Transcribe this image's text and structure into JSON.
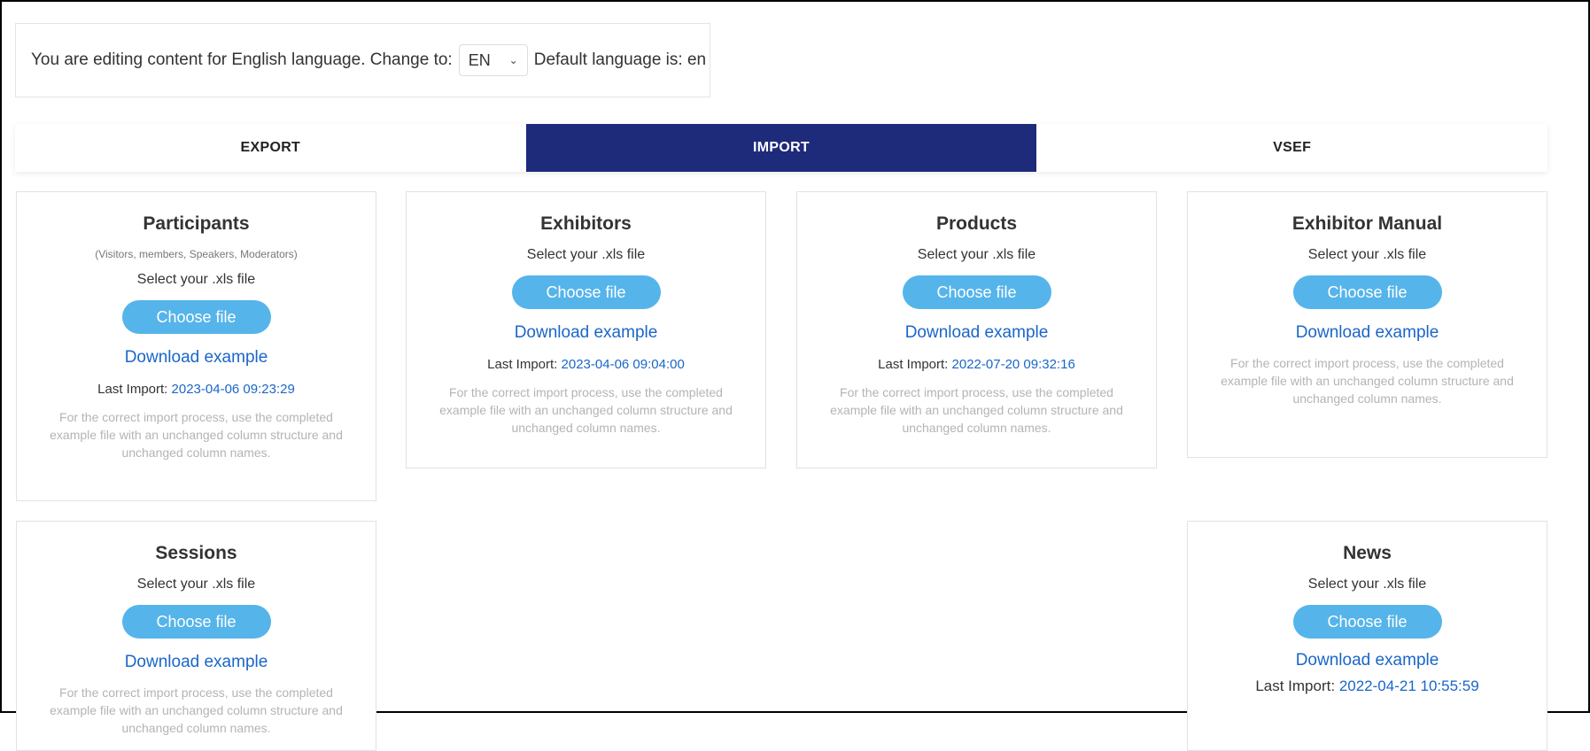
{
  "language_bar": {
    "prefix": "You are editing content for English language. Change to:",
    "selected": "EN",
    "suffix": "Default language is: en"
  },
  "tabs": [
    {
      "label": "EXPORT",
      "active": false
    },
    {
      "label": "IMPORT",
      "active": true
    },
    {
      "label": "VSEF",
      "active": false
    }
  ],
  "cards": {
    "participants": {
      "title": "Participants",
      "subtitle": "(Visitors, members, Speakers, Moderators)",
      "select_label": "Select your .xls file",
      "choose_label": "Choose file",
      "download_label": "Download example",
      "last_import_label": "Last Import:",
      "last_import_date": "2023-04-06 09:23:29",
      "hint": "For the correct import process, use the completed example file with an unchanged column structure and unchanged column names."
    },
    "exhibitors": {
      "title": "Exhibitors",
      "select_label": "Select your .xls file",
      "choose_label": "Choose file",
      "download_label": "Download example",
      "last_import_label": "Last Import:",
      "last_import_date": "2023-04-06 09:04:00",
      "hint": "For the correct import process, use the completed example file with an unchanged column structure and unchanged column names."
    },
    "products": {
      "title": "Products",
      "select_label": "Select your .xls file",
      "choose_label": "Choose file",
      "download_label": "Download example",
      "last_import_label": "Last Import:",
      "last_import_date": "2022-07-20 09:32:16",
      "hint": "For the correct import process, use the completed example file with an unchanged column structure and unchanged column names."
    },
    "exhibitor_manual": {
      "title": "Exhibitor Manual",
      "select_label": "Select your .xls file",
      "choose_label": "Choose file",
      "download_label": "Download example",
      "hint": "For the correct import process, use the completed example file with an unchanged column structure and unchanged column names."
    },
    "sessions": {
      "title": "Sessions",
      "select_label": "Select your .xls file",
      "choose_label": "Choose file",
      "download_label": "Download example",
      "hint": "For the correct import process, use the completed example file with an unchanged column structure and unchanged column names."
    },
    "news": {
      "title": "News",
      "select_label": "Select your .xls file",
      "choose_label": "Choose file",
      "download_label": "Download example",
      "last_import_label": "Last Import:",
      "last_import_date": "2022-04-21 10:55:59"
    }
  },
  "colors": {
    "tab_active": "#1e2a7a",
    "button": "#55b4ea",
    "link": "#1a66c9",
    "hint": "#b4b4b4"
  }
}
